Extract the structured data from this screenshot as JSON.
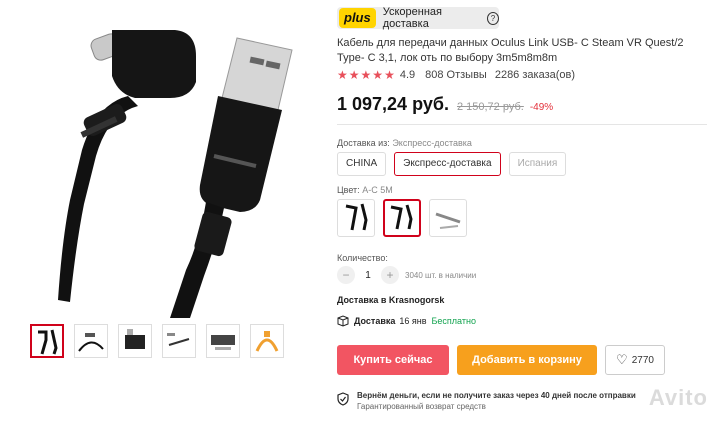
{
  "gallery": {
    "main_image": "usb-c-to-usb-a-angled-cable-photo",
    "thumbnails": [
      "cable-thumb-1",
      "cable-thumb-2",
      "cable-thumb-3",
      "cable-thumb-4",
      "cable-thumb-5",
      "cable-thumb-6"
    ],
    "active_index": 0
  },
  "plus": {
    "badge": "plus",
    "text": "Ускоренная доставка",
    "icon": "question-icon"
  },
  "product": {
    "title": "Кабель для передачи данных Oculus Link USB- C Steam VR Quest/2 Type- C 3,1, лок оть по выбору 3m5m8m8m",
    "rating": "4.9",
    "reviews": "808 Отзывы",
    "orders": "2286 заказа(ов)",
    "price": "1 097,24 руб.",
    "old_price": "2 150,72 руб.",
    "discount": "-49%"
  },
  "shipping": {
    "label": "Доставка из:",
    "selected": "Экспресс-доставка",
    "options": [
      "CHINA",
      "Экспресс-доставка",
      "Испания"
    ]
  },
  "color": {
    "label": "Цвет:",
    "selected": "A-C 5M",
    "options": [
      "angled-cable-swatch",
      "angled-cable-swatch-selected",
      "gray-cable-swatch"
    ]
  },
  "quantity": {
    "label": "Количество:",
    "value": "1",
    "minus": "−",
    "plus": "+",
    "stock": "3040 шт. в наличии"
  },
  "delivery": {
    "to": "Доставка в Krasnogorsk",
    "label": "Доставка",
    "date": "16 янв",
    "free": "Бесплатно"
  },
  "actions": {
    "buy": "Купить сейчас",
    "cart": "Добавить в корзину",
    "wishlist_count": "2770"
  },
  "guarantee": {
    "title": "Вернём деньги, если не получите заказ через 40 дней после отправки",
    "subtitle": "Гарантированный возврат средств"
  },
  "watermark": "Avito",
  "colors": {
    "accent_red": "#d0021b",
    "buy_button": "#f25562",
    "cart_button": "#f7a01d",
    "plus_yellow": "#ffd400",
    "free_green": "#12a34f"
  }
}
